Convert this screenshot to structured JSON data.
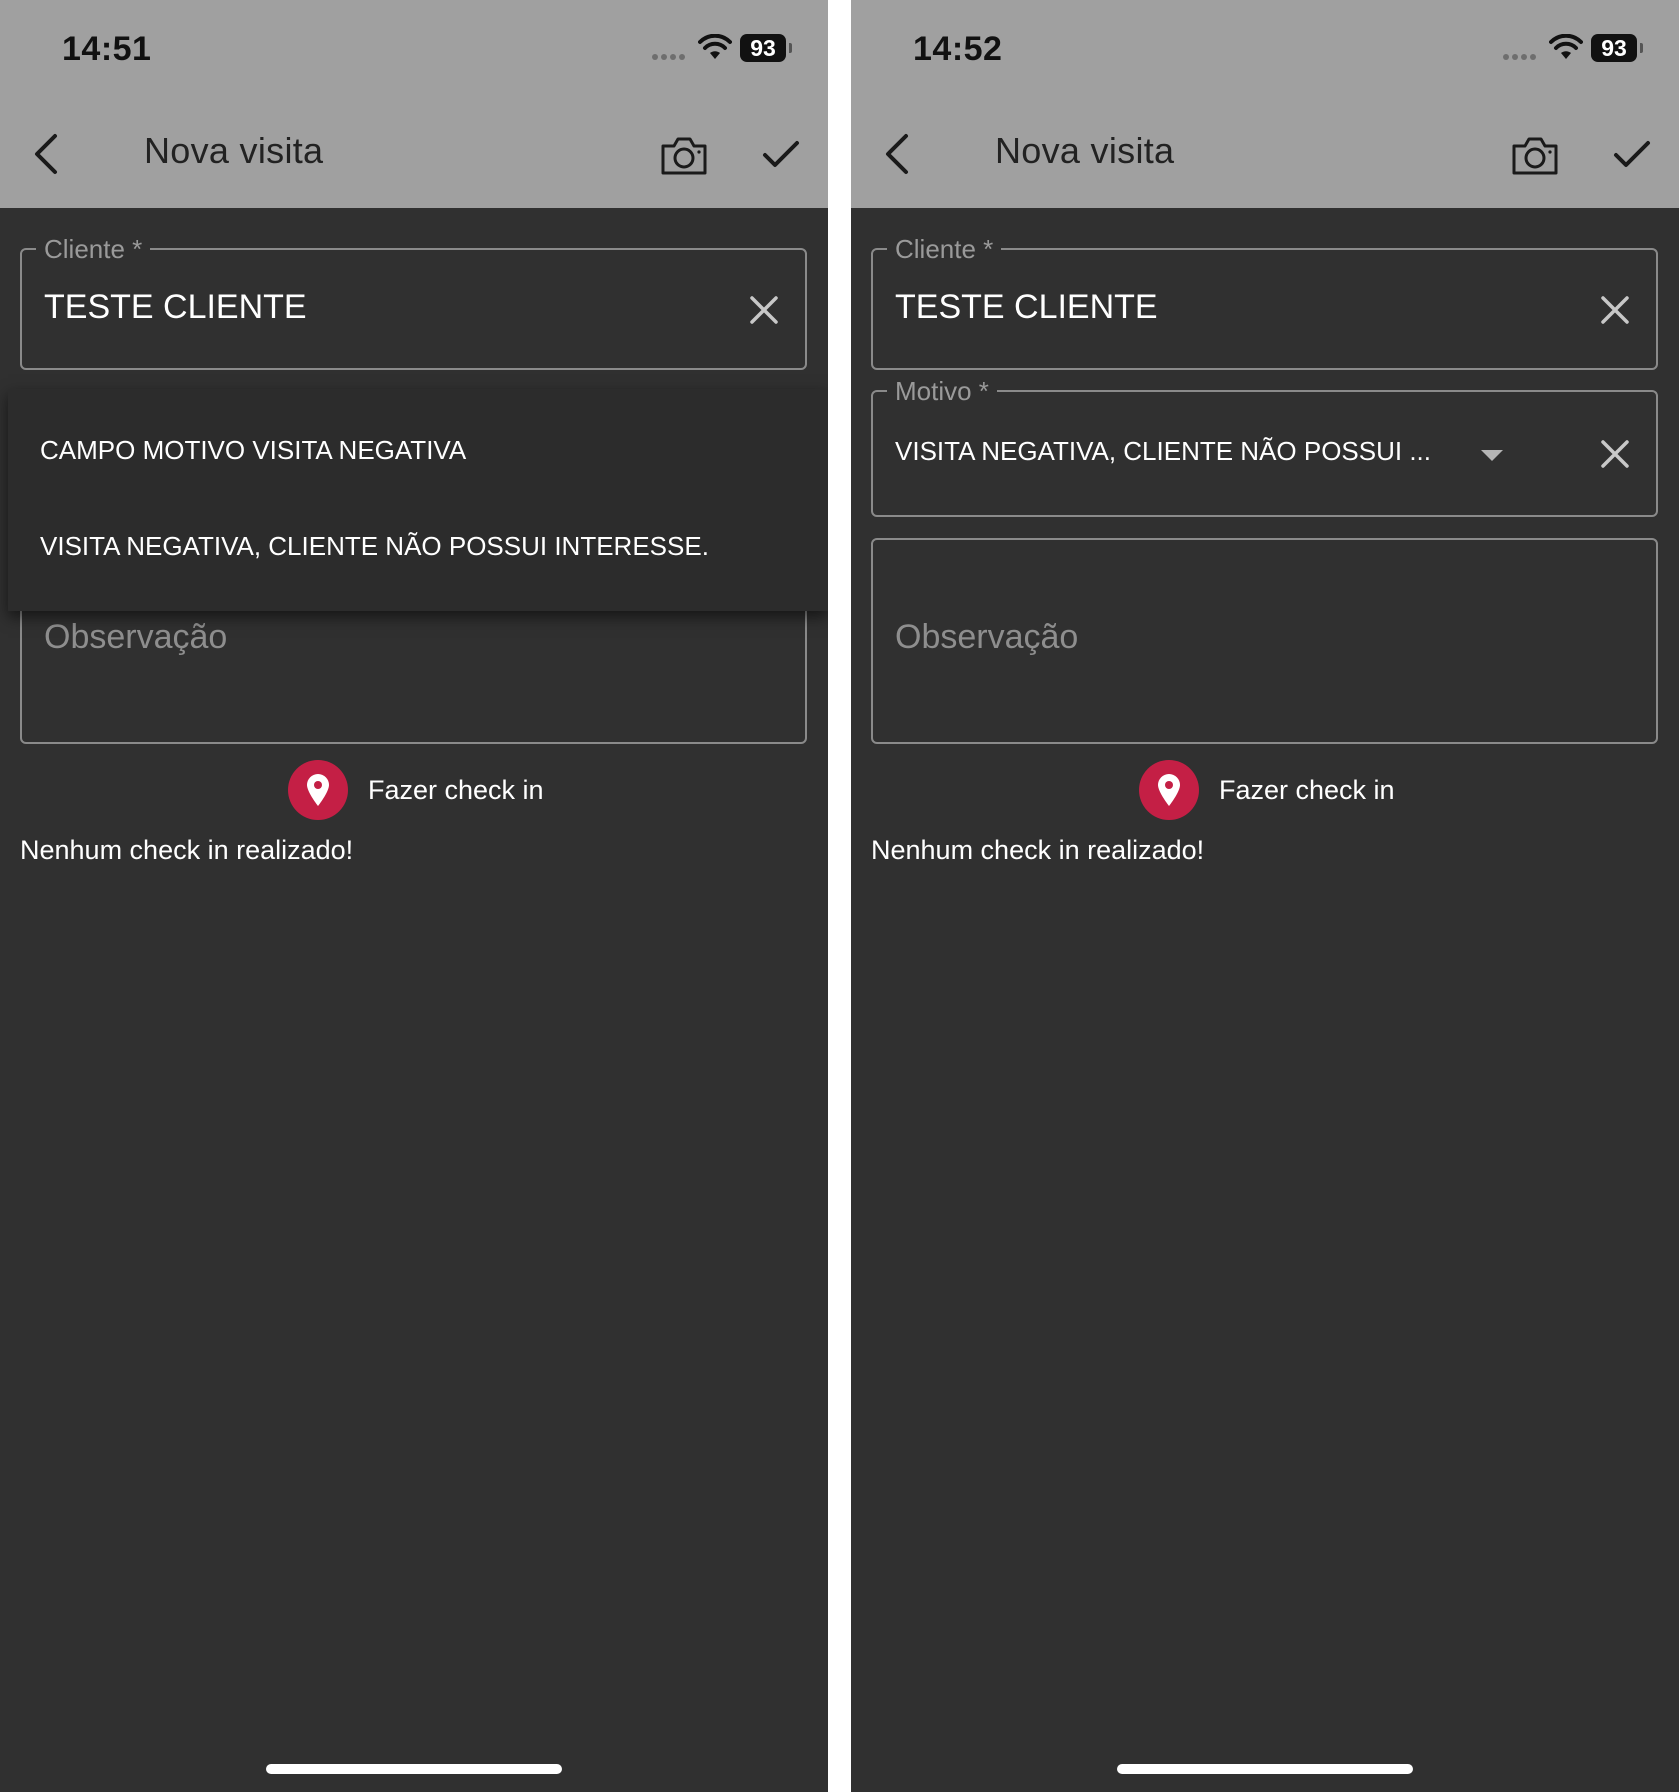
{
  "screens": [
    {
      "status": {
        "time": "14:51",
        "battery": "93"
      },
      "app_bar": {
        "title": "Nova visita"
      },
      "cliente": {
        "label": "Cliente *",
        "value": "TESTE CLIENTE"
      },
      "motivo_menu": {
        "options": [
          "CAMPO MOTIVO VISITA NEGATIVA",
          "VISITA NEGATIVA, CLIENTE NÃO POSSUI INTERESSE."
        ]
      },
      "observacao": {
        "placeholder": "Observação"
      },
      "checkin": {
        "button_label": "Fazer check in",
        "status_text": "Nenhum check in realizado!"
      }
    },
    {
      "status": {
        "time": "14:52",
        "battery": "93"
      },
      "app_bar": {
        "title": "Nova visita"
      },
      "cliente": {
        "label": "Cliente *",
        "value": "TESTE CLIENTE"
      },
      "motivo": {
        "label": "Motivo *",
        "value": "VISITA NEGATIVA, CLIENTE NÃO POSSUI ..."
      },
      "observacao": {
        "placeholder": "Observação"
      },
      "checkin": {
        "button_label": "Fazer check in",
        "status_text": "Nenhum check in realizado!"
      }
    }
  ],
  "colors": {
    "background": "#303030",
    "header": "#a0a0a0",
    "accent": "#c41f45",
    "border": "#8a8a8a"
  },
  "icons": [
    "back-arrow-icon",
    "camera-icon",
    "checkmark-icon",
    "clear-icon",
    "dropdown-arrow-icon",
    "location-pin-icon",
    "wifi-icon",
    "battery-icon",
    "cellular-signal-icon"
  ]
}
